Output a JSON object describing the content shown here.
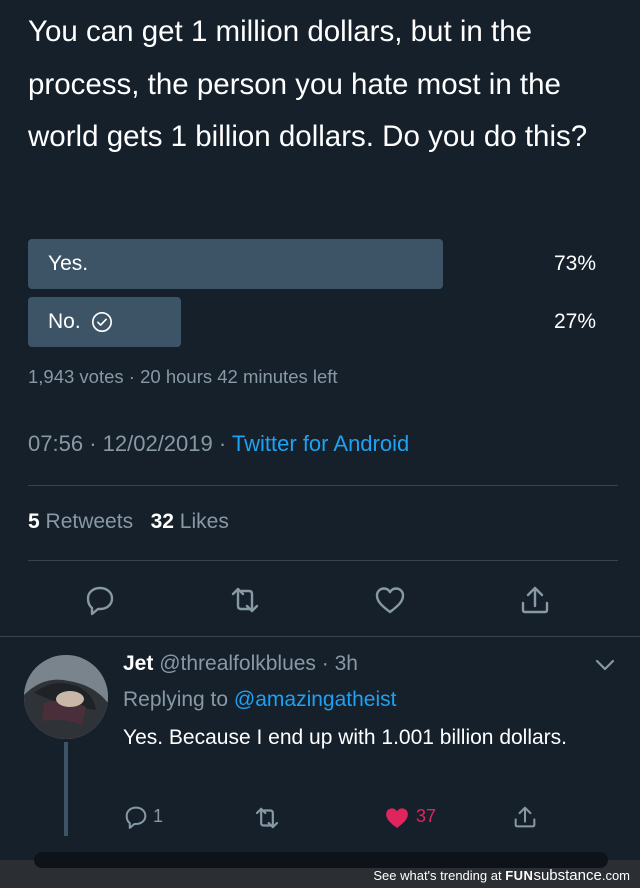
{
  "tweet": {
    "question": "You can get 1 million dollars, but in the process, the person you hate most in the world gets 1 billion dollars. Do you do this?",
    "poll": {
      "options": [
        {
          "label": "Yes.",
          "percent_text": "73%",
          "fraction": 0.73
        },
        {
          "label": "No.",
          "percent_text": "27%",
          "fraction": 0.27,
          "selected_icon": "check-circle-icon"
        }
      ],
      "votes": "1,943 votes",
      "sep": "·",
      "time_left": "20 hours 42 minutes left"
    },
    "time": "07:56",
    "date": "12/02/2019",
    "source": "Twitter for Android",
    "retweets_count": "5",
    "retweets_label": "Retweets",
    "likes_count": "32",
    "likes_label": "Likes",
    "actions": [
      "reply-icon",
      "retweet-icon",
      "like-icon",
      "share-icon"
    ]
  },
  "reply": {
    "name": "Jet",
    "handle": "@threalfolkblues",
    "time": "3h",
    "replying_label": "Replying to",
    "replying_to": "@amazingatheist",
    "text": "Yes. Because I end up with 1.001 billion dollars.",
    "reply_count": "1",
    "like_count": "37",
    "colors": {
      "like": "#e0245e"
    }
  },
  "watermark": {
    "text": "See what's trending at",
    "brand_fun": "FUN",
    "brand_rest": "substance",
    "brand_suffix": ".com"
  },
  "colors": {
    "background": "#15202b",
    "muted": "#8899a6",
    "link": "#1da1f2",
    "poll_bar": "#3d5466"
  }
}
